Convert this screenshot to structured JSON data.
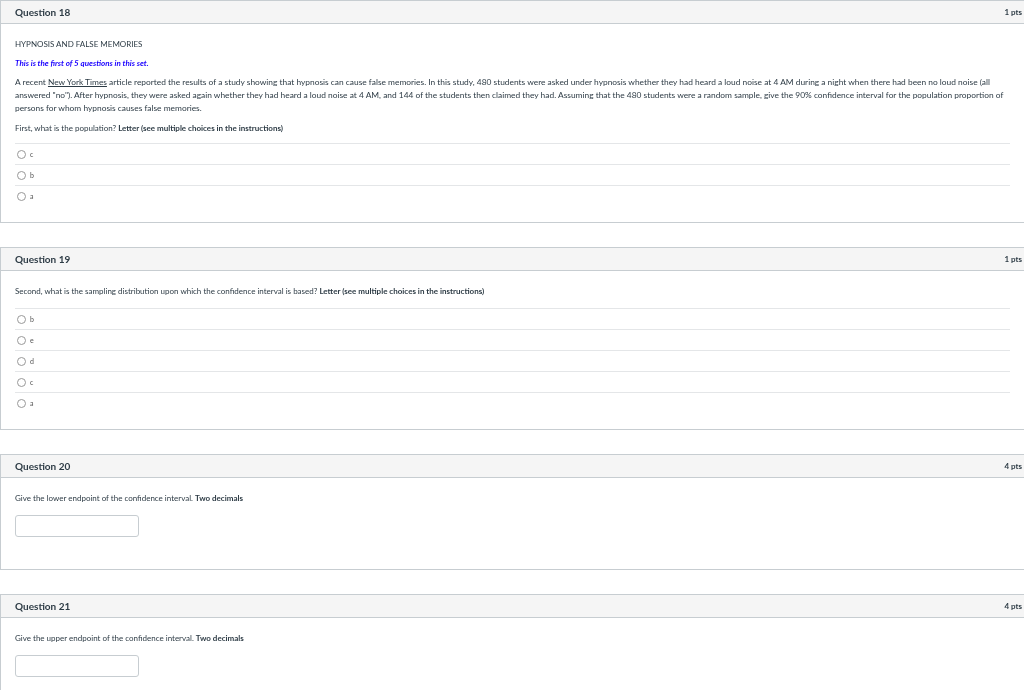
{
  "questions": [
    {
      "kind": "choice",
      "title": "Question 18",
      "points": "1 pts",
      "heading": "HYPNOSIS AND FALSE MEMORIES",
      "note": "This is the first of 5 questions in this set.",
      "passage": {
        "before": "A recent ",
        "link": "New York Times",
        "after": " article reported the results of a study showing that hypnosis can cause false memories.  In this study, 480 students were asked under hypnosis whether they had heard a loud noise at 4 AM during a night when there had been no loud noise (all answered \"no\").  After hypnosis, they were asked again whether they had heard a loud noise at 4 AM, and 144 of the students then claimed they had.  Assuming that the 480 students were a random sample, give the 90% confidence interval for the population proportion of persons for whom hypnosis causes false memories."
      },
      "prompt": "First, what is the population?  **Letter (see multiple choices in the instructions)**",
      "choices": [
        {
          "label": "c",
          "selected": false
        },
        {
          "label": "b",
          "selected": false
        },
        {
          "label": "a",
          "selected": false
        }
      ]
    },
    {
      "kind": "choice",
      "title": "Question 19",
      "points": "1 pts",
      "prompt": "Second, what is the sampling distribution upon which the confidence interval is based?  **Letter (see multiple choices in the instructions)**",
      "choices": [
        {
          "label": "b",
          "selected": false
        },
        {
          "label": "e",
          "selected": false
        },
        {
          "label": "d",
          "selected": false
        },
        {
          "label": "c",
          "selected": false
        },
        {
          "label": "a",
          "selected": false
        }
      ]
    },
    {
      "kind": "numeric",
      "title": "Question 20",
      "points": "4 pts",
      "prompt": "Give the lower endpoint of the confidence interval.  **Two decimals**"
    },
    {
      "kind": "numeric",
      "title": "Question 21",
      "points": "4 pts",
      "prompt": "Give the upper endpoint of the confidence interval.  **Two decimals**"
    }
  ]
}
